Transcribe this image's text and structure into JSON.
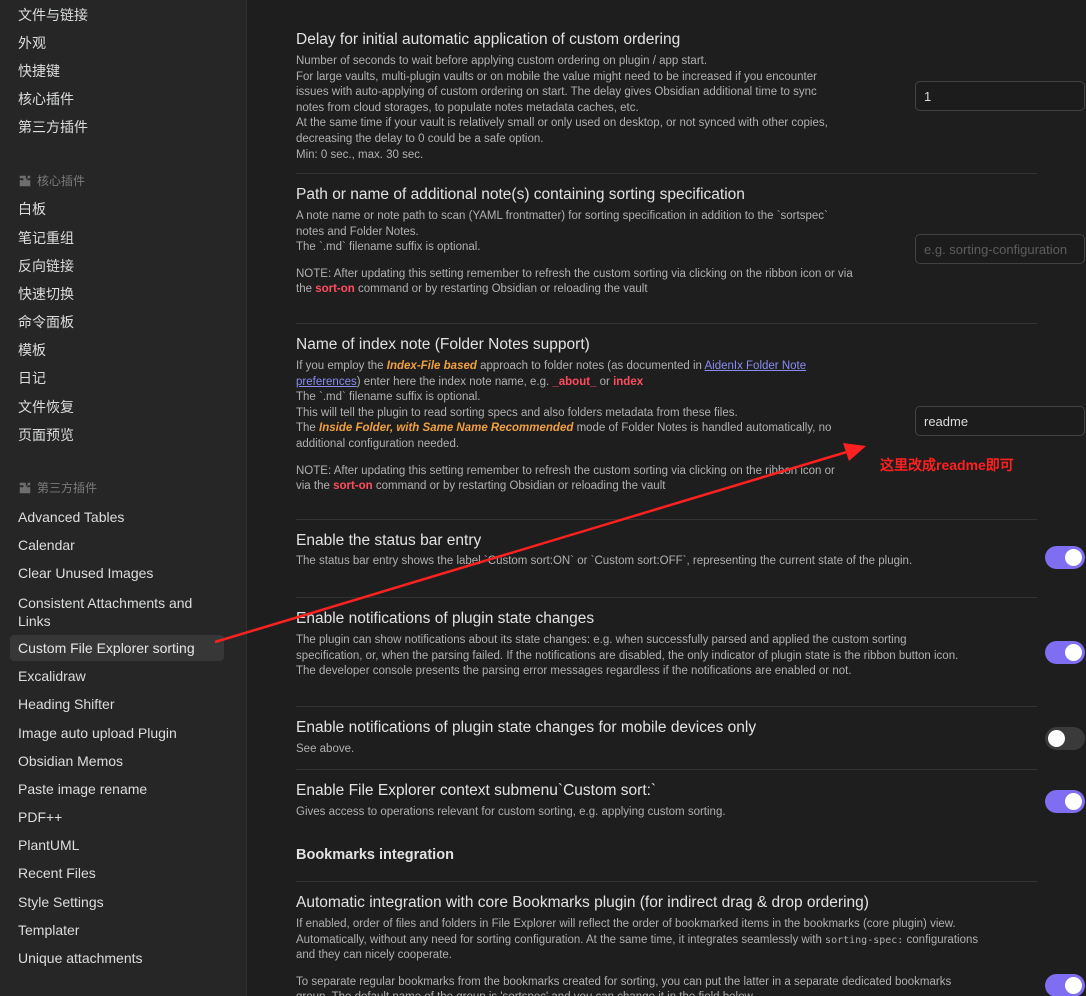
{
  "sidebar": {
    "top_items": [
      "文件与链接",
      "外观",
      "快捷键",
      "核心插件",
      "第三方插件"
    ],
    "core_header": "核心插件",
    "core_items": [
      "白板",
      "笔记重组",
      "反向链接",
      "快速切换",
      "命令面板",
      "模板",
      "日记",
      "文件恢复",
      "页面预览"
    ],
    "community_header": "第三方插件",
    "community_items": [
      "Advanced Tables",
      "Calendar",
      "Clear Unused Images",
      "Consistent Attachments and Links",
      "Custom File Explorer sorting",
      "Excalidraw",
      "Heading Shifter",
      "Image auto upload Plugin",
      "Obsidian Memos",
      "Paste image rename",
      "PDF++",
      "PlantUML",
      "Recent Files",
      "Style Settings",
      "Templater",
      "Unique attachments"
    ],
    "active_item": "Custom File Explorer sorting",
    "header_icon": "puzzle-icon"
  },
  "settings": {
    "delay": {
      "title": "Delay for initial automatic application of custom ordering",
      "lines": [
        "Number of seconds to wait before applying custom ordering on plugin / app start.",
        "For large vaults, multi-plugin vaults or on mobile the value might need to be increased if you encounter issues with auto-applying of custom ordering on start. The delay gives Obsidian additional time to sync notes from cloud storages, to populate notes metadata caches, etc.",
        "At the same time if your vault is relatively small or only used on desktop, or not synced with other copies, decreasing the delay to 0 could be a safe option.",
        "Min: 0 sec., max. 30 sec."
      ],
      "value": "1"
    },
    "path": {
      "title": "Path or name of additional note(s) containing sorting specification",
      "line1": "A note name or note path to scan (YAML frontmatter) for sorting specification in addition to the `sortspec` notes and Folder Notes.",
      "line2": "The `.md` filename suffix is optional.",
      "note_prefix": "NOTE: After updating this setting remember to refresh the custom sorting via clicking on the ribbon icon or via the ",
      "note_keyword": "sort-on",
      "note_suffix": " command or by restarting Obsidian or reloading the vault",
      "placeholder": "e.g. sorting-configuration"
    },
    "index": {
      "title": "Name of index note (Folder Notes support)",
      "p1_a": "If you employ the ",
      "p1_kw": "Index-File based",
      "p1_b": " approach to folder notes (as documented in ",
      "p1_link": "AidenIx Folder Note preferences",
      "p1_c": ") enter here the index note name, e.g. ",
      "p1_ex1": "_about_",
      "p1_or": " or ",
      "p1_ex2": "index",
      "p2": "The `.md` filename suffix is optional.",
      "p3": "This will tell the plugin to read sorting specs and also folders metadata from these files.",
      "p4_a": "The ",
      "p4_kw": "Inside Folder, with Same Name Recommended",
      "p4_b": " mode of Folder Notes is handled automatically, no additional configuration needed.",
      "note_prefix": "NOTE: After updating this setting remember to refresh the custom sorting via clicking on the ribbon icon or via the ",
      "note_keyword": "sort-on",
      "note_suffix": " command or by restarting Obsidian or reloading the vault",
      "value": "readme"
    },
    "status_bar": {
      "title": "Enable the status bar entry",
      "desc": "The status bar entry shows the label `Custom sort:ON` or `Custom sort:OFF`, representing the current state of the plugin.",
      "on": true
    },
    "notifications": {
      "title": "Enable notifications of plugin state changes",
      "desc": "The plugin can show notifications about its state changes: e.g. when successfully parsed and applied the custom sorting specification, or, when the parsing failed. If the notifications are disabled, the only indicator of plugin state is the ribbon button icon. The developer console presents the parsing error messages regardless if the notifications are enabled or not.",
      "on": true
    },
    "mobile_notifications": {
      "title": "Enable notifications of plugin state changes for mobile devices only",
      "desc": "See above.",
      "on": false
    },
    "context_menu": {
      "title": "Enable File Explorer context submenu`Custom sort:`",
      "desc": "Gives access to operations relevant for custom sorting, e.g. applying custom sorting.",
      "on": true
    },
    "bookmarks_header": "Bookmarks integration",
    "bookmarks": {
      "title": "Automatic integration with core Bookmarks plugin (for indirect drag & drop ordering)",
      "desc_a": "If enabled, order of files and folders in File Explorer will reflect the order of bookmarked items in the bookmarks (core plugin) view. Automatically, without any need for sorting configuration. At the same time, it integrates seamlessly with ",
      "desc_code": "sorting-spec:",
      "desc_b": " configurations and they can nicely cooperate.",
      "desc2": "To separate regular bookmarks from the bookmarks created for sorting, you can put the latter in a separate dedicated bookmarks group. The default name of the group is 'sortspec' and you can change it in the field below.",
      "on": true
    }
  },
  "annotation": {
    "text": "这里改成readme即可",
    "color": "#ff2020"
  },
  "colors": {
    "accent": "#7f6df2",
    "keyword_red": "#ff4d5e",
    "keyword_orange": "#f0a040",
    "link": "#8a8cf0"
  }
}
